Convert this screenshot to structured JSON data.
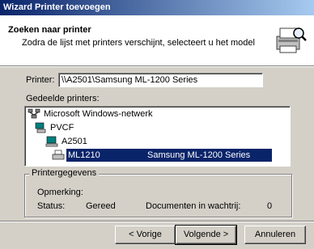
{
  "window": {
    "title": "Wizard Printer toevoegen"
  },
  "header": {
    "title": "Zoeken naar printer",
    "subtitle": "Zodra de lijst met printers verschijnt, selecteert u het model",
    "icon": "printer-search-icon"
  },
  "printer_field": {
    "label": "Printer:",
    "value": "\\\\A2501\\Samsung ML-1200 Series"
  },
  "shared_printers": {
    "label": "Gedeelde printers:",
    "tree": [
      {
        "label": "Microsoft Windows-netwerk",
        "icon": "network-icon",
        "level": 0
      },
      {
        "label": "PVCF",
        "icon": "workgroup-icon",
        "level": 1
      },
      {
        "label": "A2501",
        "icon": "computer-icon",
        "level": 2
      },
      {
        "label": "ML1210",
        "icon": "printer-icon",
        "level": 3,
        "comment": "Samsung ML-1200 Series",
        "selected": true
      }
    ]
  },
  "printer_info": {
    "title": "Printergegevens",
    "comment_label": "Opmerking:",
    "status_label": "Status:",
    "status_value": "Gereed",
    "queue_label": "Documenten in wachtrij:",
    "queue_value": "0"
  },
  "buttons": {
    "back": "< Vorige",
    "next": "Volgende >",
    "cancel": "Annuleren"
  },
  "colors": {
    "selection": "#0a246a",
    "titlebar": "#0a246a",
    "face": "#d4d0c8"
  }
}
